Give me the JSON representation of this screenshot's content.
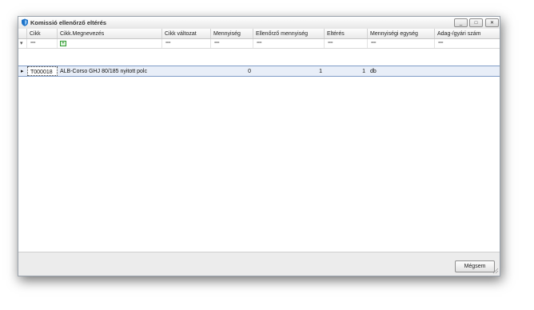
{
  "window": {
    "title": "Komissió ellenőrző eltérés",
    "controls": {
      "minimize": "_",
      "maximize": "□",
      "close": "✕"
    }
  },
  "grid": {
    "columns": [
      "Cikk",
      "Cikk.Megnevezés",
      "Cikk változat",
      "Mennyiség",
      "Ellenőrző mennyiség",
      "Eltérés",
      "Mennyiségi egység",
      "Adag-/gyári szám"
    ],
    "filter_symbol": "==",
    "row_indicator": "▸",
    "filter_indicator": "▾",
    "rows": [
      {
        "cikk": "T000018",
        "megnevezes": "ALB-Corso GHJ 80/185 nyitott polc",
        "valtozat": "",
        "mennyiseg": "0",
        "ellenorzo_mennyiseg": "1",
        "elteres": "1",
        "egyseg": "db",
        "adag": ""
      }
    ]
  },
  "footer": {
    "cancel_label": "Mégsem"
  },
  "colors": {
    "selection": "#e8eef8",
    "selection_border": "#7f9cc7",
    "title_icon": "#1e73c9"
  }
}
